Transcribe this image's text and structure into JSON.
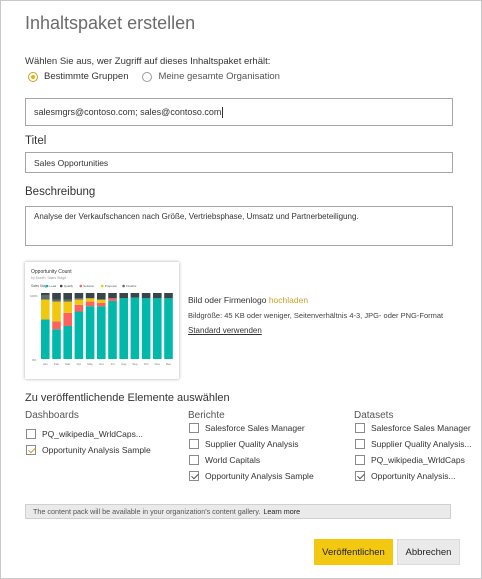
{
  "dialog": {
    "title": "Inhaltspaket erstellen",
    "access_label": "Wählen Sie aus, wer Zugriff auf dieses Inhaltspaket erhält:",
    "radio_specific": "Bestimmte Gruppen",
    "radio_org": "Meine gesamte Organisation",
    "email_value": "salesmgrs@contoso.com; sales@contoso.com",
    "title_label": "Titel",
    "title_value": "Sales Opportunities",
    "desc_label": "Beschreibung",
    "desc_value": "Analyse der Verkaufschancen nach Größe, Vertriebsphase, Umsatz und Partnerbeteiligung.",
    "logo_text": "Bild oder Firmenlogo",
    "logo_link": "hochladen",
    "logo_sub": "Bildgröße: 45 KB oder weniger, Seitenverhältnis 4-3, JPG- oder PNG-Format",
    "std_link": "Standard verwenden",
    "select_heading": "Zu veröffentlichende Elemente auswählen",
    "colors": {
      "accent": "#f2c811",
      "link": "#c9a227"
    }
  },
  "thumbnail": {
    "title": "Opportunity Count",
    "subtitle": "by Month, Sales Stage",
    "legend_label": "Sales Stage",
    "legend": [
      "Lead",
      "Qualify",
      "Solution",
      "Proposal",
      "Finalize"
    ],
    "series_colors": [
      "#01b8aa",
      "#374649",
      "#fd625e",
      "#f2c80f",
      "#5f6b6d"
    ],
    "months": [
      "Jan",
      "Feb",
      "Mar",
      "Apr",
      "May",
      "Jun",
      "Jul",
      "Aug",
      "Sep",
      "Oct",
      "Nov",
      "Dec"
    ],
    "y_top": "100%",
    "y_bottom": "0%"
  },
  "columns": {
    "dashboards": {
      "heading": "Dashboards",
      "items": [
        {
          "label": "PQ_wikipedia_WrldCaps...",
          "checked": false
        },
        {
          "label": "Opportunity Analysis Sample",
          "checked": true
        }
      ]
    },
    "reports": {
      "heading": "Berichte",
      "items": [
        {
          "label": "Salesforce Sales Manager",
          "checked": false
        },
        {
          "label": "Supplier Quality Analysis",
          "checked": false
        },
        {
          "label": "World Capitals",
          "checked": false
        },
        {
          "label": "Opportunity Analysis Sample",
          "checked": true
        }
      ]
    },
    "datasets": {
      "heading": "Datasets",
      "items": [
        {
          "label": "Salesforce Sales Manager",
          "checked": false
        },
        {
          "label": "Supplier Quality Analysis...",
          "checked": false
        },
        {
          "label": "PQ_wikipedia_WrldCaps",
          "checked": false
        },
        {
          "label": "Opportunity Analysis...",
          "checked": true
        }
      ]
    }
  },
  "notice": {
    "text": "The content pack will be available in your organization's content gallery.",
    "link": "Learn more"
  },
  "buttons": {
    "publish": "Veröffentlichen",
    "cancel": "Abbrechen"
  }
}
